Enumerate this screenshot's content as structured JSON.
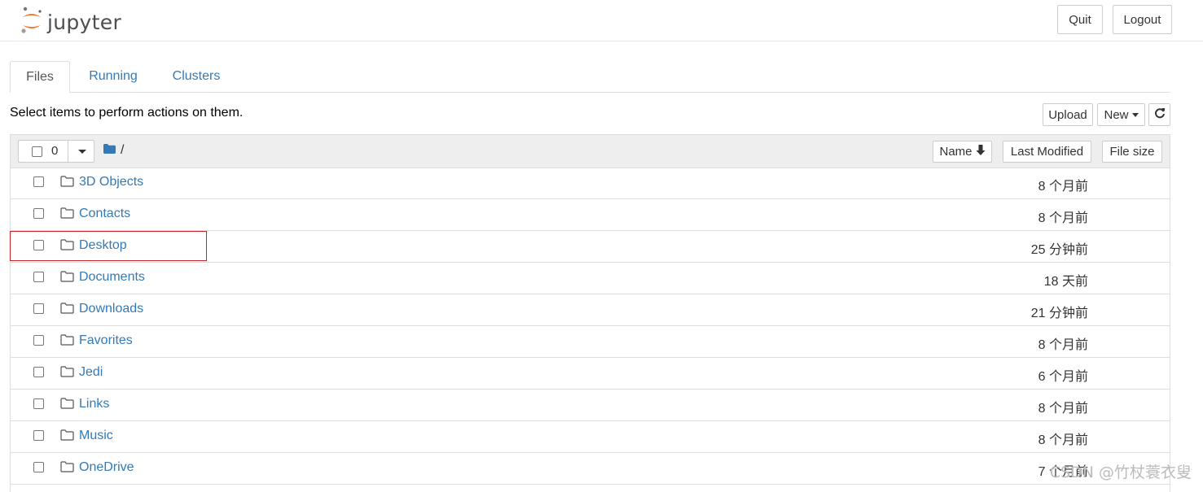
{
  "header": {
    "logo_text": "jupyter",
    "quit_label": "Quit",
    "logout_label": "Logout"
  },
  "tabs": [
    {
      "label": "Files",
      "active": true
    },
    {
      "label": "Running",
      "active": false
    },
    {
      "label": "Clusters",
      "active": false
    }
  ],
  "toolbar": {
    "info_text": "Select items to perform actions on them.",
    "upload_label": "Upload",
    "new_label": "New",
    "refresh_icon": "refresh-icon"
  },
  "list_header": {
    "selected_count": "0",
    "breadcrumb": "/",
    "sort_name_label": "Name",
    "sort_modified_label": "Last Modified",
    "sort_size_label": "File size"
  },
  "files": [
    {
      "name": "3D Objects",
      "modified": "8 个月前"
    },
    {
      "name": "Contacts",
      "modified": "8 个月前"
    },
    {
      "name": "Desktop",
      "modified": "25 分钟前"
    },
    {
      "name": "Documents",
      "modified": "18 天前"
    },
    {
      "name": "Downloads",
      "modified": "21 分钟前"
    },
    {
      "name": "Favorites",
      "modified": "8 个月前"
    },
    {
      "name": "Jedi",
      "modified": "6 个月前"
    },
    {
      "name": "Links",
      "modified": "8 个月前"
    },
    {
      "name": "Music",
      "modified": "8 个月前"
    },
    {
      "name": "OneDrive",
      "modified": "7 个月前"
    }
  ],
  "watermark": "CSDN @竹杖蓑衣叟",
  "colors": {
    "link": "#337ab7",
    "highlight": "#c7212b",
    "logo_orange": "#f37726"
  }
}
